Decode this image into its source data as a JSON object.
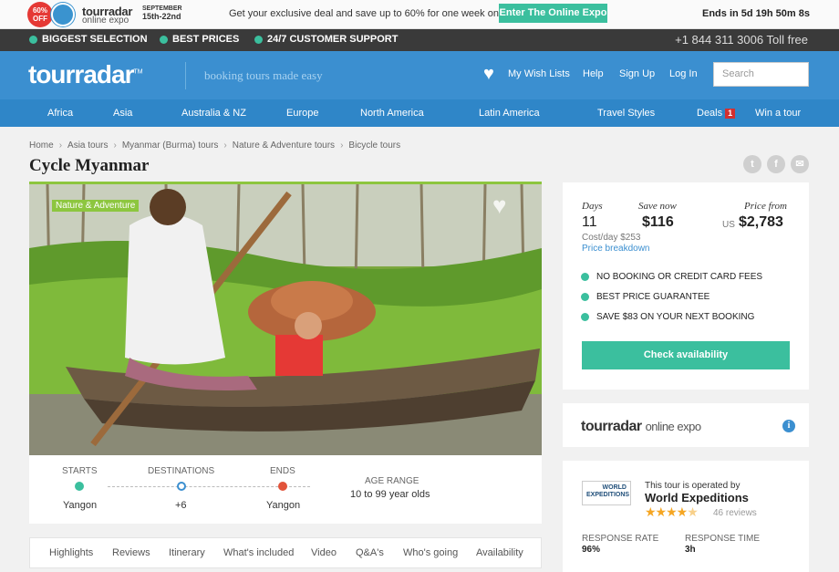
{
  "promo": {
    "sale_badge": "60% OFF",
    "expo_logo": "tourradar",
    "expo_sub": "online expo",
    "expo_month": "SEPTEMBER",
    "expo_dates": "15th-22nd",
    "deal_text": "Get your exclusive deal and save up to 60% for one week only",
    "enter_button": "Enter The Online Expo",
    "countdown": "Ends in 5d 19h 50m 8s"
  },
  "usp": {
    "items": [
      "BIGGEST SELECTION",
      "BEST PRICES",
      "24/7 CUSTOMER SUPPORT"
    ],
    "phone": "+1 844 311 3006 Toll free"
  },
  "header": {
    "logo": "tourradar",
    "logo_tm": "TM",
    "tagline": "booking tours made easy",
    "links": [
      "My Wish Lists",
      "Help",
      "Sign Up",
      "Log In"
    ],
    "search_placeholder": "Search"
  },
  "regions": {
    "items": [
      "Africa",
      "Asia",
      "Australia & NZ",
      "Europe",
      "North America",
      "Latin America",
      "Travel Styles",
      "Deals",
      "Win a tour"
    ],
    "deals_badge": "1"
  },
  "breadcrumb": [
    "Home",
    "Asia tours",
    "Myanmar (Burma) tours",
    "Nature & Adventure tours",
    "Bicycle tours"
  ],
  "tour": {
    "title": "Cycle Myanmar",
    "category": "Nature & Adventure",
    "route": {
      "starts_label": "STARTS",
      "starts": "Yangon",
      "destinations_label": "DESTINATIONS",
      "destinations": "+6",
      "ends_label": "ENDS",
      "ends": "Yangon",
      "age_label": "AGE RANGE",
      "age": "10 to 99 year olds"
    },
    "tabs": [
      "Highlights",
      "Reviews",
      "Itinerary",
      "What's included",
      "Video",
      "Q&A's",
      "Who's going",
      "Availability"
    ]
  },
  "booking": {
    "days_label": "Days",
    "days": "11",
    "save_label": "Save now",
    "save": "$116",
    "price_label": "Price from",
    "currency": "US",
    "price": "$2,783",
    "cost_per_day": "Cost/day $253",
    "breakdown_link": "Price breakdown",
    "benefits": [
      "NO BOOKING OR CREDIT CARD FEES",
      "BEST PRICE GUARANTEE",
      "SAVE $83 ON YOUR NEXT BOOKING"
    ],
    "cta": "Check availability"
  },
  "expo_card": {
    "logo": "tourradar",
    "sub": "online expo",
    "info": "i"
  },
  "operator": {
    "logo_text": "WORLD EXPEDITIONS",
    "operated_by": "This tour is operated by",
    "name": "World Expeditions",
    "rating": 4.5,
    "reviews": "46 reviews",
    "response_rate_label": "RESPONSE RATE",
    "response_rate": "96%",
    "response_time_label": "RESPONSE TIME",
    "response_time": "3h"
  }
}
